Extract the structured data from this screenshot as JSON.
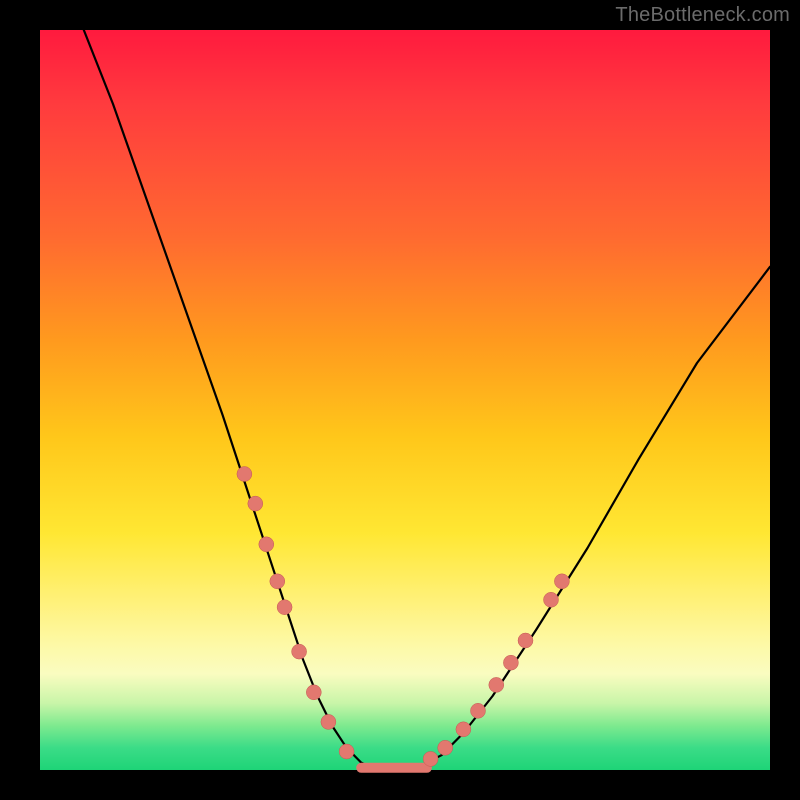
{
  "watermark": "TheBottleneck.com",
  "colors": {
    "curve": "#000000",
    "dot_fill": "#e2786f",
    "dot_stroke": "#c45a52",
    "background_black": "#000000",
    "gradient_top": "#ff1a3e",
    "gradient_bottom": "#1ed477"
  },
  "chart_data": {
    "type": "line",
    "title": "",
    "xlabel": "",
    "ylabel": "",
    "xlim": [
      0,
      100
    ],
    "ylim": [
      0,
      100
    ],
    "grid": false,
    "series": [
      {
        "name": "bottleneck-curve",
        "x": [
          6,
          10,
          15,
          20,
          25,
          28,
          30,
          32,
          34,
          36,
          38,
          40,
          42,
          44,
          46,
          48,
          50,
          52,
          55,
          58,
          62,
          68,
          75,
          82,
          90,
          100
        ],
        "y": [
          100,
          90,
          76,
          62,
          48,
          39,
          33,
          27,
          21,
          15,
          10,
          6,
          3,
          1,
          0,
          0,
          0,
          0.5,
          2,
          5,
          10,
          19,
          30,
          42,
          55,
          68
        ]
      }
    ],
    "dots_left": [
      {
        "x": 28.0,
        "y": 40.0
      },
      {
        "x": 29.5,
        "y": 36.0
      },
      {
        "x": 31.0,
        "y": 30.5
      },
      {
        "x": 32.5,
        "y": 25.5
      },
      {
        "x": 33.5,
        "y": 22.0
      },
      {
        "x": 35.5,
        "y": 16.0
      },
      {
        "x": 37.5,
        "y": 10.5
      },
      {
        "x": 39.5,
        "y": 6.5
      },
      {
        "x": 42.0,
        "y": 2.5
      }
    ],
    "dots_right": [
      {
        "x": 53.5,
        "y": 1.5
      },
      {
        "x": 55.5,
        "y": 3.0
      },
      {
        "x": 58.0,
        "y": 5.5
      },
      {
        "x": 60.0,
        "y": 8.0
      },
      {
        "x": 62.5,
        "y": 11.5
      },
      {
        "x": 64.5,
        "y": 14.5
      },
      {
        "x": 66.5,
        "y": 17.5
      },
      {
        "x": 70.0,
        "y": 23.0
      },
      {
        "x": 71.5,
        "y": 25.5
      }
    ],
    "flat_segment": {
      "x_start": 44,
      "x_end": 53,
      "y": 0.3,
      "thickness_px": 10
    }
  }
}
